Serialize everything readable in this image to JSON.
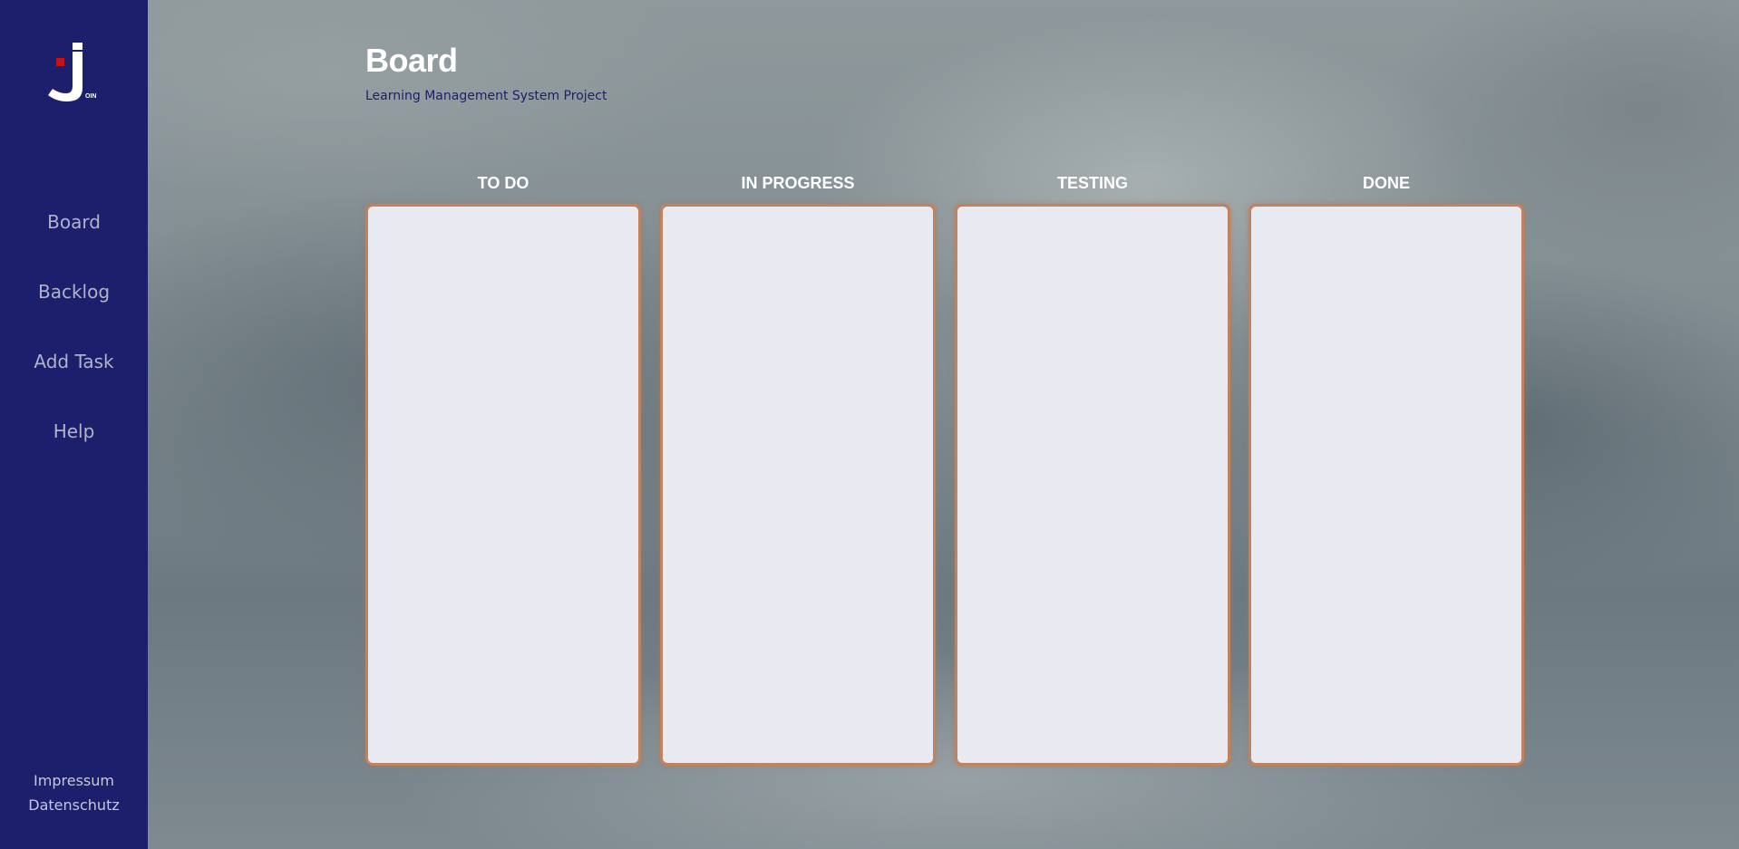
{
  "app": {
    "logo": {
      "letter": "J",
      "suffix": "OIN",
      "accent_color": "#c0141a"
    }
  },
  "sidebar": {
    "background": "#1c1f6b",
    "items": [
      {
        "label": "Board"
      },
      {
        "label": "Backlog"
      },
      {
        "label": "Add Task"
      },
      {
        "label": "Help"
      }
    ],
    "footer": [
      {
        "label": "Impressum"
      },
      {
        "label": "Datenschutz"
      }
    ]
  },
  "main": {
    "title": "Board",
    "subtitle": "Learning Management System Project",
    "columns": [
      {
        "title": "TO DO"
      },
      {
        "title": "IN PROGRESS"
      },
      {
        "title": "TESTING"
      },
      {
        "title": "DONE"
      }
    ],
    "column_border_color": "#c0825f"
  }
}
